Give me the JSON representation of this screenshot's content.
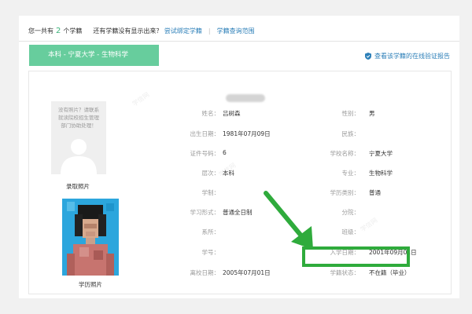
{
  "topbar": {
    "prefix": "您一共有",
    "count": "2",
    "suffix": "个学籍",
    "notice": "还有学籍没有显示出来？",
    "bind_link": "尝试绑定学籍",
    "separator": "|",
    "scope_link": "学籍查询范围"
  },
  "school_tab": "本科 - 宁夏大学 - 生物科学",
  "verify_link": "查看该学籍的在线验证报告",
  "photos": {
    "placeholder_text": "没有照片？请联系就读院校招生管理部门协助处理！",
    "admission_caption": "录取照片",
    "diploma_caption": "学历照片"
  },
  "fields": {
    "name": {
      "label": "姓名：",
      "value": "吕树森"
    },
    "gender": {
      "label": "性别：",
      "value": "男"
    },
    "birth": {
      "label": "出生日期：",
      "value": "1981年07月09日"
    },
    "ethnicity": {
      "label": "民族：",
      "value": ""
    },
    "id_no": {
      "label": "证件号码：",
      "value": "6"
    },
    "school": {
      "label": "学校名称：",
      "value": "宁夏大学"
    },
    "level": {
      "label": "层次：",
      "value": "本科"
    },
    "major": {
      "label": "专业：",
      "value": "生物科学"
    },
    "duration": {
      "label": "学制：",
      "value": ""
    },
    "edu_type": {
      "label": "学历类别：",
      "value": "普通"
    },
    "form": {
      "label": "学习形式：",
      "value": "普通全日制"
    },
    "branch": {
      "label": "分院：",
      "value": ""
    },
    "dept": {
      "label": "系所：",
      "value": ""
    },
    "class": {
      "label": "班级：",
      "value": ""
    },
    "student_no": {
      "label": "学号：",
      "value": ""
    },
    "enroll": {
      "label": "入学日期：",
      "value": "2001年09月01日"
    },
    "leave": {
      "label": "离校日期：",
      "value": "2005年07月01日"
    },
    "status": {
      "label": "学籍状态：",
      "value": "不在籍（毕业）"
    }
  },
  "colors": {
    "tab_bg": "#67cd9d",
    "link": "#2c7fb8",
    "highlight": "#2fab3c",
    "count": "#3bb37a"
  }
}
